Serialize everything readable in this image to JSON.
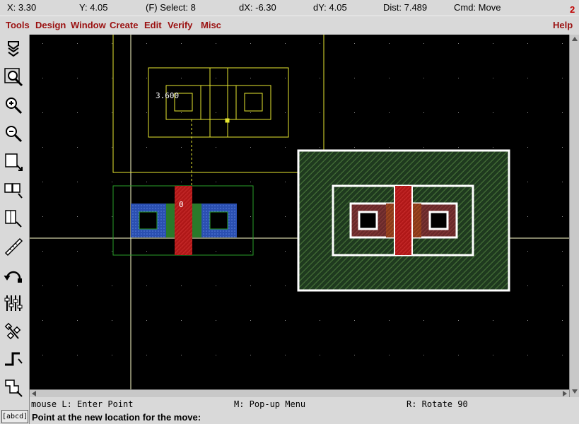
{
  "status": {
    "x": "X:  3.30",
    "y": "Y:  4.05",
    "select": "(F) Select: 8",
    "dx": "dX:  -6.30",
    "dy": "dY:  4.05",
    "dist": "Dist: 7.489",
    "cmd": "Cmd: Move",
    "window_number": "2"
  },
  "menu": {
    "items": [
      "Tools",
      "Design",
      "Window",
      "Create",
      "Edit",
      "Verify",
      "Misc"
    ],
    "help": "Help"
  },
  "toolbar": {
    "tools": [
      "save-icon",
      "zoom-fit-icon",
      "zoom-in-icon",
      "zoom-out-icon",
      "select-box-icon",
      "stretch-icon",
      "partial-select-icon",
      "ruler-icon",
      "undo-icon",
      "property-icon",
      "hierarchy-icon",
      "path-icon",
      "polygon-icon"
    ],
    "label_tool": "[abcd]"
  },
  "canvas": {
    "ruler_label": "3.600",
    "ruler_zero_label": "0",
    "colors": {
      "background": "#000000",
      "grid": "#7a7a7a",
      "highlight": "#ffff33",
      "selected": "#ffffff",
      "poly": "#cc2222",
      "active": "#2a8a2a",
      "metal": "#3a5fcd"
    }
  },
  "mouse_bar": {
    "left": "mouse L: Enter Point",
    "middle": "M: Pop-up Menu",
    "right": "R: Rotate 90"
  },
  "prompt": {
    "text": "Point at the new location for the move:"
  }
}
